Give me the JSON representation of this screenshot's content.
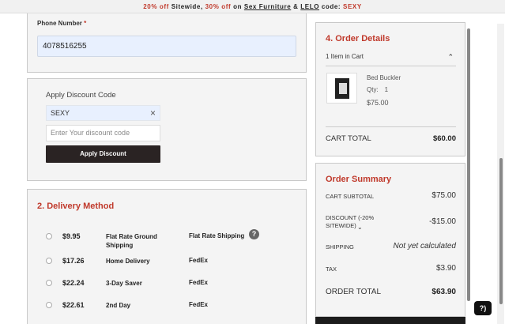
{
  "promo": {
    "part1": "20% off",
    "part2": " Sitewide, ",
    "part3": "30% off",
    "part4": " on ",
    "part5": "Sex Furniture",
    "part6": " & ",
    "part7": "LELO",
    "part8": " code: ",
    "part9": "SEXY"
  },
  "phone": {
    "label": "Phone Number",
    "required_mark": "*",
    "value": "4078516255"
  },
  "discount": {
    "title": "Apply Discount Code",
    "applied_code": "SEXY",
    "remove_icon": "×",
    "placeholder": "Enter Your discount code",
    "button": "Apply Discount"
  },
  "delivery": {
    "title": "2. Delivery Method",
    "help_icon": "?",
    "options": [
      {
        "price": "$9.95",
        "name": "Flat Rate Ground Shipping",
        "carrier": "Flat Rate Shipping"
      },
      {
        "price": "$17.26",
        "name": "Home Delivery",
        "carrier": "FedEx"
      },
      {
        "price": "$22.24",
        "name": "3-Day Saver",
        "carrier": "FedEx"
      },
      {
        "price": "$22.61",
        "name": "2nd Day",
        "carrier": "FedEx"
      }
    ]
  },
  "order_details": {
    "title": "4. Order Details",
    "items_count": "1 Item in Cart",
    "chevron": "⌃",
    "item": {
      "name": "Bed Buckler",
      "qty_label": "Qty:",
      "qty": "1",
      "price": "$75.00"
    },
    "cart_total_label": "CART TOTAL",
    "cart_total": "$60.00"
  },
  "summary": {
    "title": "Order Summary",
    "rows": [
      {
        "label": "CART SUBTOTAL",
        "value": "$75.00"
      },
      {
        "label": "DISCOUNT (-20% SITEWIDE)",
        "value": "-$15.00"
      },
      {
        "label": "SHIPPING",
        "value": "Not yet calculated"
      },
      {
        "label": "TAX",
        "value": "$3.90"
      }
    ],
    "total_label": "ORDER TOTAL",
    "total": "$63.90"
  },
  "chat": {
    "label": "?)"
  }
}
